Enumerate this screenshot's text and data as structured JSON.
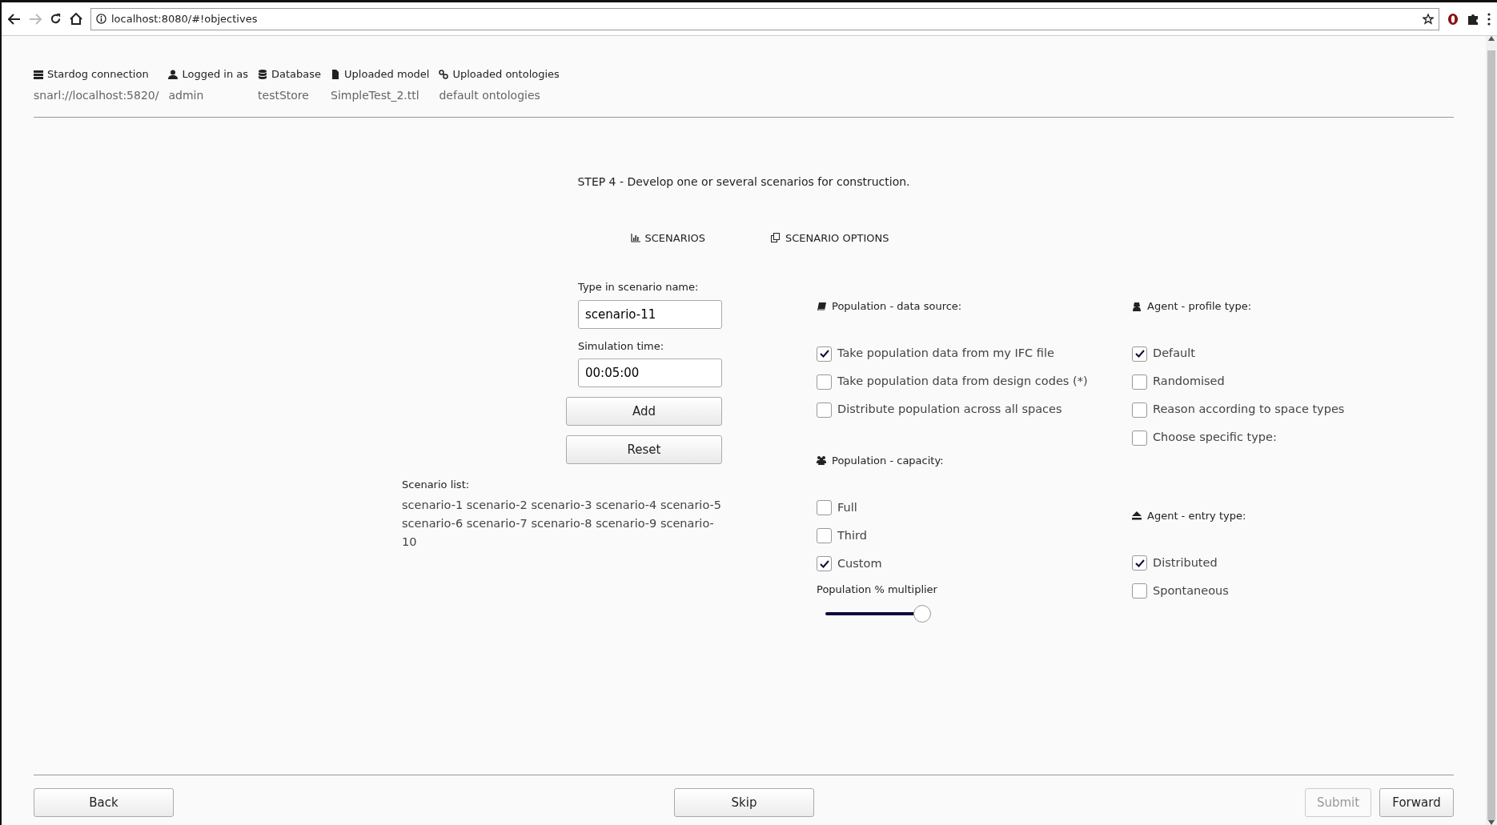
{
  "browser": {
    "url": "localhost:8080/#!objectives",
    "forward_disabled": true
  },
  "connection_info": [
    {
      "label": "Stardog connection",
      "value": "snarl://localhost:5820/"
    },
    {
      "label": "Logged in as",
      "value": "admin"
    },
    {
      "label": "Database",
      "value": "testStore"
    },
    {
      "label": "Uploaded model",
      "value": "SimpleTest_2.ttl"
    },
    {
      "label": "Uploaded ontologies",
      "value": "default ontologies"
    }
  ],
  "step_title": "STEP 4 - Develop one or several scenarios for construction.",
  "tabs": [
    {
      "label": "SCENARIOS"
    },
    {
      "label": "SCENARIO OPTIONS"
    }
  ],
  "scenario_form": {
    "name_label": "Type in scenario name:",
    "name_value": "scenario-11",
    "time_label": "Simulation time:",
    "time_value": "00:05:00",
    "buttons": [
      "Add",
      "Reset"
    ],
    "list_label": "Scenario list:",
    "list_text": "scenario-1 scenario-2 scenario-3 scenario-4 scenario-5 scenario-6 scenario-7 scenario-8 scenario-9 scenario-10"
  },
  "option_columns": [
    [
      {
        "title": "Population - data source:",
        "options": [
          {
            "label": "Take population data from my IFC file",
            "checked": true
          },
          {
            "label": "Take population data from design codes (*)",
            "checked": false
          },
          {
            "label": "Distribute population across all spaces",
            "checked": false
          }
        ]
      },
      {
        "title": "Population - capacity:",
        "options": [
          {
            "label": "Full",
            "checked": false
          },
          {
            "label": "Third",
            "checked": false
          },
          {
            "label": "Custom",
            "checked": true
          }
        ],
        "slider": {
          "label": "Population % multiplier",
          "level": 0.92
        }
      }
    ],
    [
      {
        "title": "Agent - profile type:",
        "options": [
          {
            "label": "Default",
            "checked": true
          },
          {
            "label": "Randomised",
            "checked": false
          },
          {
            "label": "Reason according to space types",
            "checked": false
          },
          {
            "label": "Choose specific type:",
            "checked": false
          }
        ]
      },
      {
        "title": "Agent - entry type:",
        "options": [
          {
            "label": "Distributed",
            "checked": true
          },
          {
            "label": "Spontaneous",
            "checked": false
          }
        ]
      }
    ]
  ],
  "footer_buttons": [
    {
      "label": "Back",
      "disabled": false
    },
    {
      "label": "Skip",
      "disabled": false
    },
    {
      "label": "Submit",
      "disabled": true
    },
    {
      "label": "Forward",
      "disabled": false
    }
  ]
}
